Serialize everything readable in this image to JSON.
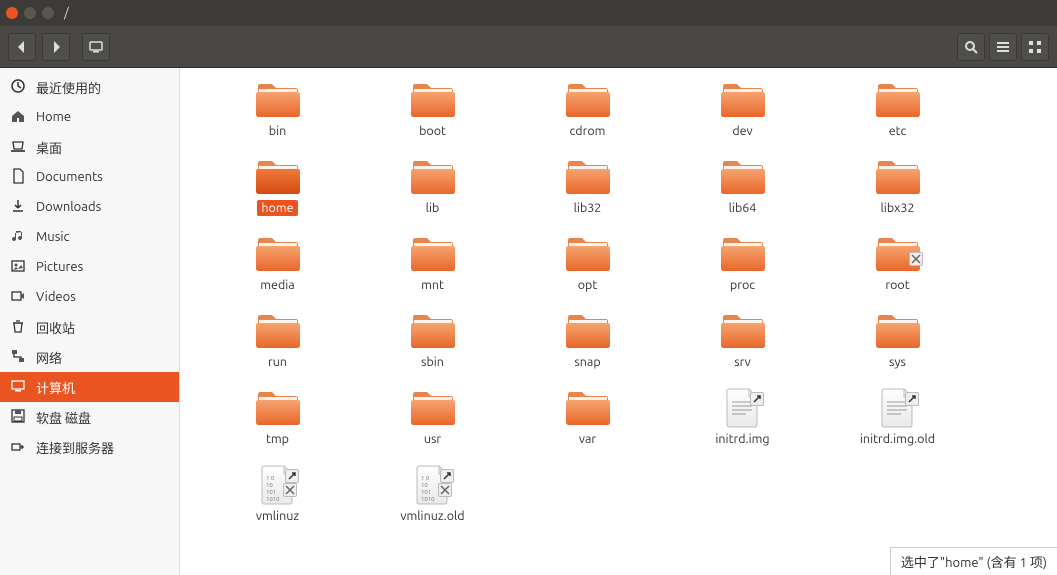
{
  "window": {
    "title": "/"
  },
  "sidebar": {
    "items": [
      {
        "id": "recent",
        "label": "最近使用的",
        "icon": "clock"
      },
      {
        "id": "home",
        "label": "Home",
        "icon": "home"
      },
      {
        "id": "desktop",
        "label": "桌面",
        "icon": "desktop"
      },
      {
        "id": "documents",
        "label": "Documents",
        "icon": "doc"
      },
      {
        "id": "downloads",
        "label": "Downloads",
        "icon": "download"
      },
      {
        "id": "music",
        "label": "Music",
        "icon": "music"
      },
      {
        "id": "pictures",
        "label": "Pictures",
        "icon": "pictures"
      },
      {
        "id": "videos",
        "label": "Videos",
        "icon": "videos"
      },
      {
        "id": "trash",
        "label": "回收站",
        "icon": "trash"
      },
      {
        "id": "network",
        "label": "网络",
        "icon": "network"
      },
      {
        "id": "computer",
        "label": "计算机",
        "icon": "computer",
        "selected": true
      },
      {
        "id": "floppy",
        "label": "软盘 磁盘",
        "icon": "floppy"
      },
      {
        "id": "connect",
        "label": "连接到服务器",
        "icon": "connect"
      }
    ]
  },
  "items": [
    {
      "name": "bin",
      "type": "folder"
    },
    {
      "name": "boot",
      "type": "folder"
    },
    {
      "name": "cdrom",
      "type": "folder"
    },
    {
      "name": "dev",
      "type": "folder"
    },
    {
      "name": "etc",
      "type": "folder"
    },
    {
      "name": "home",
      "type": "folder",
      "selected": true
    },
    {
      "name": "lib",
      "type": "folder"
    },
    {
      "name": "lib32",
      "type": "folder"
    },
    {
      "name": "lib64",
      "type": "folder"
    },
    {
      "name": "libx32",
      "type": "folder"
    },
    {
      "name": "media",
      "type": "folder"
    },
    {
      "name": "mnt",
      "type": "folder"
    },
    {
      "name": "opt",
      "type": "folder"
    },
    {
      "name": "proc",
      "type": "folder"
    },
    {
      "name": "root",
      "type": "folder-locked"
    },
    {
      "name": "run",
      "type": "folder"
    },
    {
      "name": "sbin",
      "type": "folder"
    },
    {
      "name": "snap",
      "type": "folder"
    },
    {
      "name": "srv",
      "type": "folder"
    },
    {
      "name": "sys",
      "type": "folder"
    },
    {
      "name": "tmp",
      "type": "folder"
    },
    {
      "name": "usr",
      "type": "folder"
    },
    {
      "name": "var",
      "type": "folder"
    },
    {
      "name": "initrd.img",
      "type": "file-link"
    },
    {
      "name": "initrd.img.old",
      "type": "file-link"
    },
    {
      "name": "vmlinuz",
      "type": "file-link-locked"
    },
    {
      "name": "vmlinuz.old",
      "type": "file-link-locked"
    }
  ],
  "status": "选中了\"home\" (含有 1 项)",
  "colors": {
    "accent": "#e95420"
  }
}
